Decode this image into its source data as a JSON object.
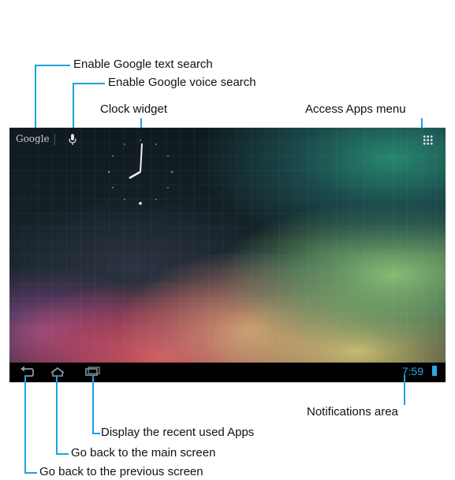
{
  "callouts": {
    "google_text_search": "Enable Google text search",
    "google_voice_search": "Enable Google voice search",
    "clock_widget": "Clock widget",
    "access_apps_menu": "Access Apps menu",
    "notifications_area": "Notifications area",
    "recent_apps": "Display the recent used Apps",
    "main_screen": "Go back to the main screen",
    "previous_screen": "Go back to the previous screen"
  },
  "screen": {
    "search_label": "Google",
    "clock_time": "7:59",
    "icons": {
      "voice": "microphone-icon",
      "apps": "apps-grid-icon",
      "back": "back-icon",
      "home": "home-icon",
      "recent": "recent-apps-icon",
      "battery": "battery-icon"
    }
  },
  "colors": {
    "callout_line": "#1aa3e0",
    "status_time": "#2ea8e0",
    "navbar": "#000000"
  }
}
